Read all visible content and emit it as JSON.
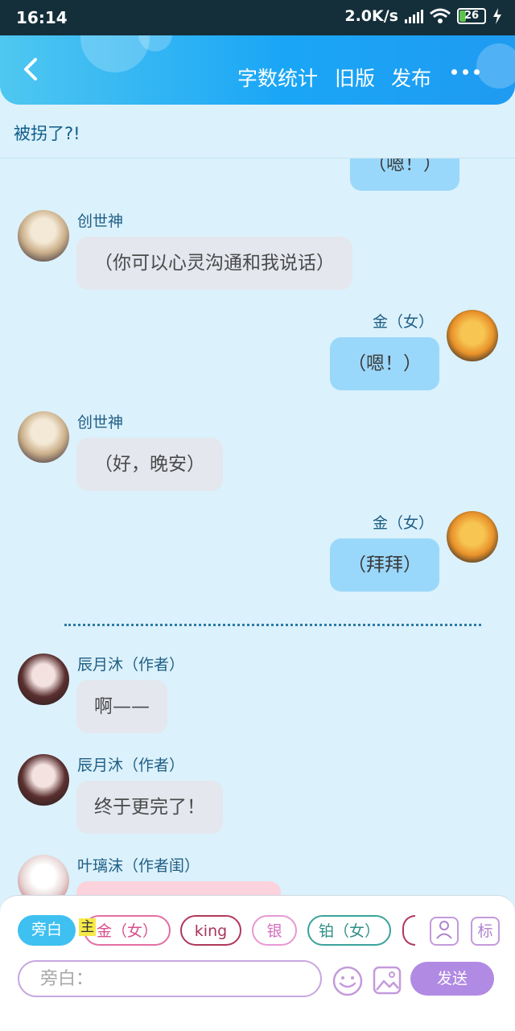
{
  "status_bar": {
    "time": "16:14",
    "network_speed": "2.0K/s",
    "battery": "26"
  },
  "header": {
    "buttons": [
      "字数统计",
      "旧版",
      "发布"
    ]
  },
  "page_title": "被拐了?!",
  "messages": [
    {
      "side": "right",
      "sender": "",
      "text": "（嗯！）",
      "style": "blue"
    },
    {
      "side": "left",
      "sender": "创世神",
      "text": "（你可以心灵沟通和我说话）",
      "style": "grey"
    },
    {
      "side": "right",
      "sender": "金（女）",
      "text": "（嗯！）",
      "style": "blue"
    },
    {
      "side": "left",
      "sender": "创世神",
      "text": "（好，晚安）",
      "style": "grey"
    },
    {
      "side": "right",
      "sender": "金（女）",
      "text": "（拜拜）",
      "style": "blue"
    },
    {
      "side": "left",
      "sender": "辰月沐（作者）",
      "text": "啊——",
      "style": "grey"
    },
    {
      "side": "left",
      "sender": "辰月沐（作者）",
      "text": "终于更完了！",
      "style": "grey"
    },
    {
      "side": "left",
      "sender": "叶璃沫（作者闺）",
      "text": "",
      "style": "pink"
    }
  ],
  "composer": {
    "roles": [
      "旁白",
      "金（女）",
      "king",
      "银",
      "铂（女）"
    ],
    "host_mark": "主",
    "tag_label": "标",
    "input_placeholder": "旁白：",
    "send_label": "发送"
  },
  "colors": {
    "header_gradient": [
      "#4fc7f0",
      "#1f9bf2"
    ],
    "background": "#dbf1fb",
    "send_button": "#b18ae3",
    "active_chip": "#3ec0f0"
  }
}
